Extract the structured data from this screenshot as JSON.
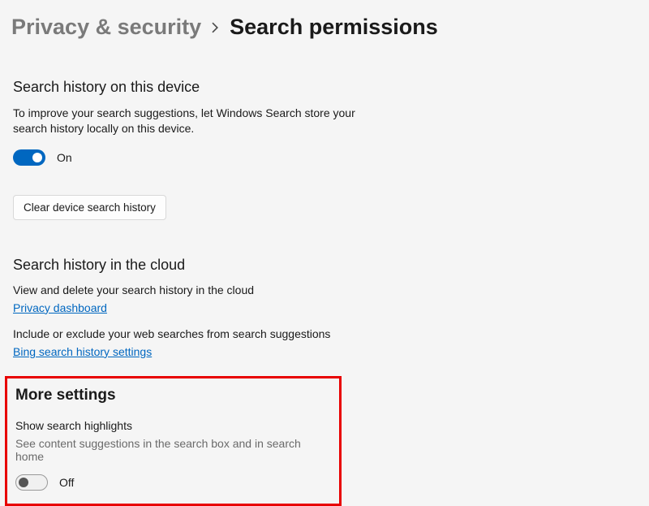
{
  "breadcrumb": {
    "parent": "Privacy & security",
    "current": "Search permissions"
  },
  "historyDevice": {
    "heading": "Search history on this device",
    "desc": "To improve your search suggestions, let Windows Search store your search history locally on this device.",
    "toggleState": "On",
    "button": "Clear device search history"
  },
  "historyCloud": {
    "heading": "Search history in the cloud",
    "line1": "View and delete your search history in the cloud",
    "link1": "Privacy dashboard",
    "line2": "Include or exclude your web searches from search suggestions",
    "link2": "Bing search history settings"
  },
  "more": {
    "heading": "More settings",
    "sub": "Show search highlights",
    "desc": "See content suggestions in the search box and in search home",
    "toggleState": "Off"
  }
}
